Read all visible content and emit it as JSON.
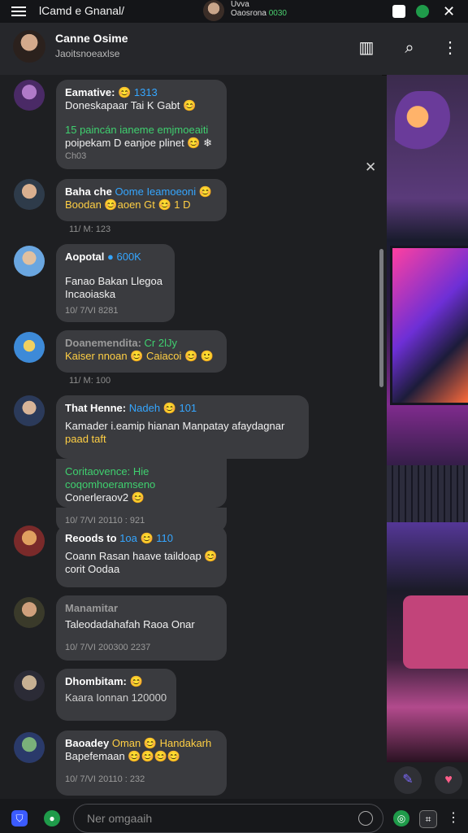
{
  "topbar": {
    "title": "lCamd e Gnanal/",
    "center_line1": "Uvva",
    "center_line2": "Oaosrona",
    "center_badge": "0030"
  },
  "header": {
    "name": "Canne Osime",
    "subtitle": "Jaoitsnoeaxlse"
  },
  "messages": [
    {
      "name": "Eamative:",
      "emoji": "😊",
      "extra": "1313",
      "line1": "Doneskapaar Tai K Gabt 😊",
      "line2": "15 paincán ianeme emjmoeaiti",
      "line3": "poipekam D eanjoe plinet 😊 ❄",
      "time": "Ch03"
    },
    {
      "name": "Baha che",
      "extra": "Oome Ieamoeoni 😊",
      "line1": "Boodan 😊aoen Gt 😊 1 D",
      "time": "11/ M: 123"
    },
    {
      "name": "Aopotal",
      "extra": "● 600K",
      "line1": "Fanao Bakan Llegoa",
      "line2": "Incaoiaska",
      "time": "10/ 7/VI 8281"
    },
    {
      "name": "Doanemendita:",
      "extra": "Cr 2lJy",
      "line1": "Kaiser nnoan 😊 Caiacoi 😊 🙂",
      "time": "11/ M: 100"
    },
    {
      "name": "That Henne:",
      "extra": "Nadeh 😊 101",
      "line1": "Kamader i.eamip hianan Manpatay afaydagnar",
      "line2": "paad taft",
      "line3": "Coritaovence: Hie coqomhoeramseno",
      "line4": "Conerleraov2 😊",
      "time": "10/ 7/VI 20110 : 921"
    },
    {
      "name": "Reoods to",
      "extra": "1oa 😊 110",
      "line1": "Coann Rasan haave taildoap 😊",
      "line2": "corit Oodaa",
      "time": ""
    },
    {
      "name": "Manamitar",
      "line1": "Taleodadahafah Raoa Onar",
      "time": "10/ 7/VI 200300 2237"
    },
    {
      "name": "Dhombitam:",
      "extra": "😊",
      "line1": "Kaara Ionnan 120000",
      "time": ""
    },
    {
      "name": "Baoadey",
      "extra": "Oman 😊 Handakarh",
      "line1": "Bapefemaan 😊😊😊😊",
      "time": "10/ 7/VI 20110 : 232"
    }
  ],
  "input": {
    "placeholder": "Ner omgaaih"
  },
  "colors": {
    "accent_blue": "#35a6ff",
    "accent_green": "#3fd06f",
    "bubble": "#3a3b3f",
    "background": "#1e1f22"
  },
  "icons": [
    "menu-icon",
    "discord-icon",
    "green-status-icon",
    "close-icon",
    "stats-icon",
    "search-icon",
    "more-icon",
    "pen-icon",
    "heart-icon",
    "shield-icon",
    "emoji-icon",
    "gif-icon"
  ]
}
